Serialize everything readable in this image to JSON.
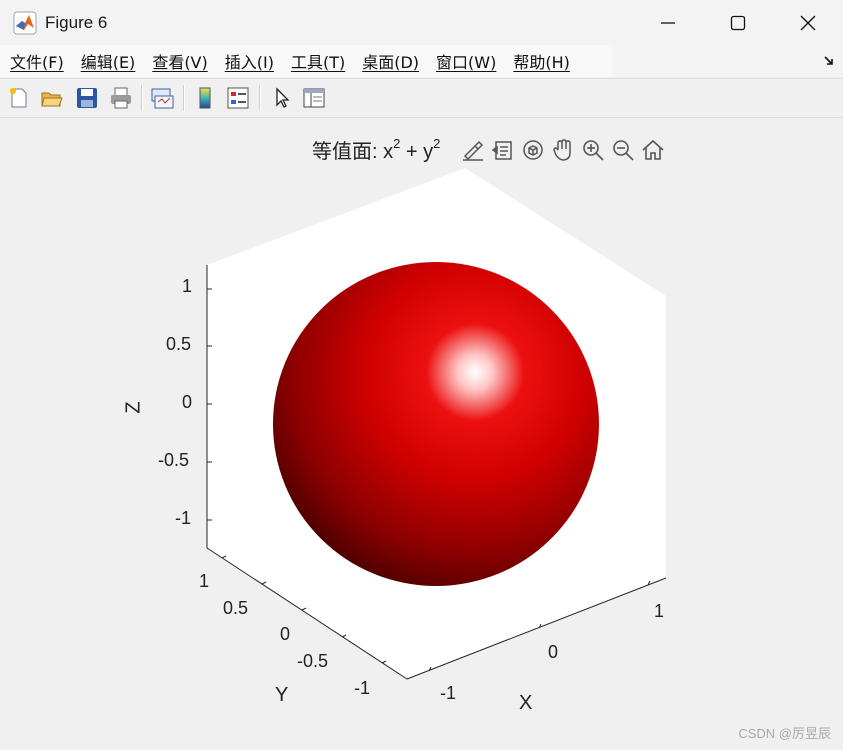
{
  "window": {
    "title": "Figure 6",
    "buttons": [
      "minimize",
      "maximize",
      "close"
    ]
  },
  "menu": {
    "items": [
      "文件(F)",
      "编辑(E)",
      "查看(V)",
      "插入(I)",
      "工具(T)",
      "桌面(D)",
      "窗口(W)",
      "帮助(H)"
    ]
  },
  "toolbar": {
    "icons": [
      "new-figure-icon",
      "open-file-icon",
      "save-icon",
      "print-icon",
      "link-plot-icon",
      "colorbar-icon",
      "legend-icon",
      "edit-plot-icon",
      "property-inspector-icon"
    ]
  },
  "plot": {
    "title_prefix": "等值面: x",
    "title_mid": " + y",
    "title_exp1": "2",
    "title_exp2": "2",
    "axes_tools": [
      "brush-icon",
      "data-tips-icon",
      "rotate-3d-icon",
      "pan-icon",
      "zoom-in-icon",
      "zoom-out-icon",
      "home-icon"
    ],
    "surface_color": "#d40000",
    "z_label": "Z",
    "y_label": "Y",
    "x_label": "X",
    "z_ticks": [
      "1",
      "0.5",
      "0",
      "-0.5",
      "-1"
    ],
    "y_ticks": [
      "1",
      "0.5",
      "0",
      "-0.5",
      "-1"
    ],
    "x_ticks": [
      "-1",
      "0",
      "1"
    ]
  },
  "watermark": "CSDN @厉昱辰"
}
